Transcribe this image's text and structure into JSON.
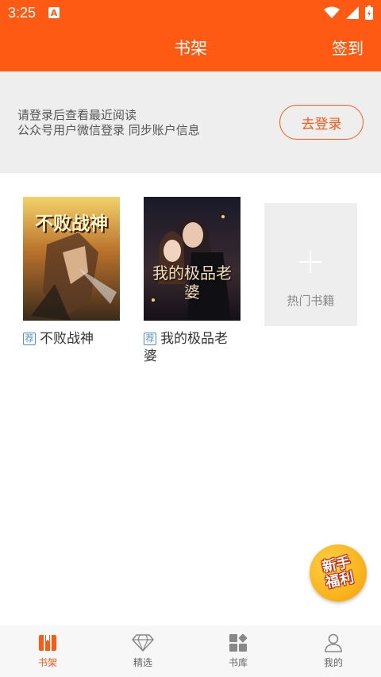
{
  "status_bar": {
    "time": "3:25",
    "app_icon": "A"
  },
  "header": {
    "title": "书架",
    "checkin_label": "签到"
  },
  "login_prompt": {
    "line1": "请登录后查看最近阅读",
    "line2": "公众号用户微信登录 同步账户信息",
    "button_label": "去登录"
  },
  "books": [
    {
      "tag": "荐",
      "title": "不败战神",
      "cover_text": "不败战神"
    },
    {
      "tag": "荐",
      "title": "我的极品老婆",
      "cover_text": "我的极品老婆"
    }
  ],
  "add_tile": {
    "label": "热门书籍"
  },
  "welfare_badge": {
    "line1": "新手",
    "line2": "福利"
  },
  "tabs": [
    {
      "label": "书架",
      "icon": "bookshelf-icon",
      "active": true
    },
    {
      "label": "精选",
      "icon": "diamond-icon",
      "active": false
    },
    {
      "label": "书库",
      "icon": "library-grid-icon",
      "active": false
    },
    {
      "label": "我的",
      "icon": "user-icon",
      "active": false
    }
  ],
  "colors": {
    "accent": "#ff5a14",
    "tag_blue": "#4a90e2",
    "panel_gray": "#eeeeee"
  }
}
